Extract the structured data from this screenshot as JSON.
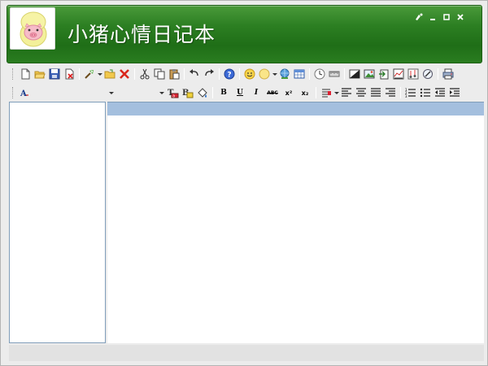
{
  "app": {
    "title": "小猪心情日记本"
  },
  "window_controls": {
    "skin": "skin-icon",
    "minimize": "minimize-icon",
    "maximize": "maximize-icon",
    "close": "close-icon"
  },
  "toolbar1": {
    "icons": [
      "new-document-icon",
      "open-folder-icon",
      "save-icon",
      "delete-file-icon",
      "tools-icon",
      "folder-icon",
      "delete-icon",
      "cut-icon",
      "copy-icon",
      "paste-icon",
      "undo-icon",
      "redo-icon",
      "help-icon",
      "emoticon-icon",
      "mood-icon",
      "globe-user-icon",
      "table-icon",
      "clock-icon",
      "ruler-icon",
      "image-icon",
      "picture-icon",
      "export-icon",
      "chart-icon",
      "music-icon",
      "print-icon"
    ]
  },
  "toolbar2": {
    "font_name": "",
    "font_size": "",
    "bold": "B",
    "underline": "U",
    "italic": "I",
    "strike": "ABC",
    "superscript": "x²",
    "subscript": "x₂"
  },
  "colors": {
    "header_green": "#2c7f22",
    "editor_bar": "#a4bfde"
  }
}
